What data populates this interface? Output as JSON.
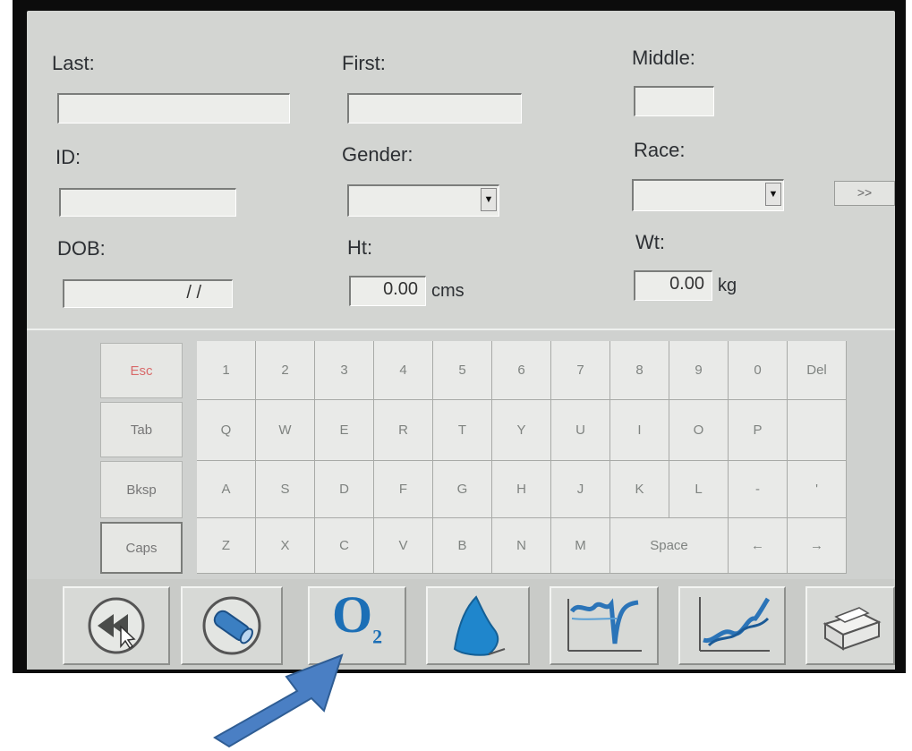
{
  "form": {
    "last_label": "Last:",
    "first_label": "First:",
    "middle_label": "Middle:",
    "id_label": "ID:",
    "gender_label": "Gender:",
    "race_label": "Race:",
    "dob_label": "DOB:",
    "ht_label": "Ht:",
    "wt_label": "Wt:",
    "last_value": "",
    "first_value": "",
    "middle_value": "",
    "id_value": "",
    "gender_value": "",
    "race_value": "",
    "dob_value": "/ /",
    "ht_value": "0.00",
    "ht_unit": "cms",
    "wt_value": "0.00",
    "wt_unit": "kg",
    "next_label": ">>"
  },
  "keyboard": {
    "function_keys": [
      "Esc",
      "Tab",
      "Bksp",
      "Caps"
    ],
    "rows": [
      [
        "1",
        "2",
        "3",
        "4",
        "5",
        "6",
        "7",
        "8",
        "9",
        "0",
        "Del"
      ],
      [
        "Q",
        "W",
        "E",
        "R",
        "T",
        "Y",
        "U",
        "I",
        "O",
        "P",
        ""
      ],
      [
        "A",
        "S",
        "D",
        "F",
        "G",
        "H",
        "J",
        "K",
        "L",
        "-",
        "'"
      ],
      [
        "Z",
        "X",
        "C",
        "V",
        "B",
        "N",
        "M",
        "Space",
        "←",
        "→"
      ]
    ]
  },
  "toolbar": {
    "o2_label": "O",
    "o2_sub": "2",
    "icons": [
      "rewind-icon",
      "mouthpiece-icon",
      "o2-icon",
      "lung-icon",
      "flow-curve-icon",
      "graph-icon",
      "printer-icon"
    ]
  },
  "colors": {
    "esc_key": "#d86a6a",
    "o2_blue": "#1c6fb6",
    "arrow_fill": "#4a7fc4",
    "panel": "#d3d5d2"
  }
}
